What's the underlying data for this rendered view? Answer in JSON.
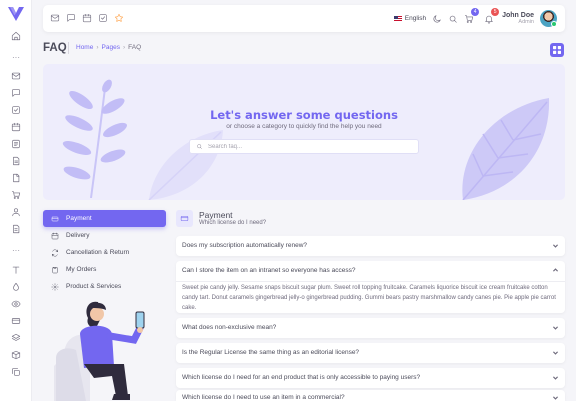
{
  "topbar": {
    "language": "English",
    "notification_count": "4",
    "alert_count": "5",
    "user_name": "John Doe",
    "user_role": "Admin"
  },
  "header": {
    "title": "FAQ",
    "breadcrumb": [
      "Home",
      "Pages",
      "FAQ"
    ]
  },
  "hero": {
    "heading": "Let's answer some questions",
    "subheading": "or choose a category to quickly find the help you need",
    "search_placeholder": "Search faq..."
  },
  "categories": [
    {
      "label": "Payment",
      "icon": "credit-card-icon",
      "active": true
    },
    {
      "label": "Delivery",
      "icon": "calendar-icon",
      "active": false
    },
    {
      "label": "Cancellation & Return",
      "icon": "refresh-icon",
      "active": false
    },
    {
      "label": "My Orders",
      "icon": "clipboard-icon",
      "active": false
    },
    {
      "label": "Product & Services",
      "icon": "gear-icon",
      "active": false
    }
  ],
  "faq": {
    "title": "Payment",
    "subtitle": "Which license do I need?",
    "items": [
      {
        "question": "Does my subscription automatically renew?",
        "expanded": false
      },
      {
        "question": "Can I store the item on an intranet so everyone has access?",
        "expanded": true,
        "answer": "Sweet pie candy jelly. Sesame snaps biscuit sugar plum. Sweet roll topping fruitcake. Caramels liquorice biscuit ice cream fruitcake cotton candy tart. Donut caramels gingerbread jelly-o gingerbread pudding. Gummi bears pastry marshmallow candy canes pie. Pie apple pie carrot cake."
      },
      {
        "question": "What does non-exclusive mean?",
        "expanded": false
      },
      {
        "question": "Is the Regular License the same thing as an editorial license?",
        "expanded": false
      },
      {
        "question": "Which license do I need for an end product that is only accessible to paying users?",
        "expanded": false
      },
      {
        "question": "Which license do I need to use an item in a commercial?",
        "expanded": false
      }
    ]
  },
  "colors": {
    "primary": "#7367f0",
    "hero_bg": "#eeedfc",
    "background": "#f5f5f9"
  }
}
